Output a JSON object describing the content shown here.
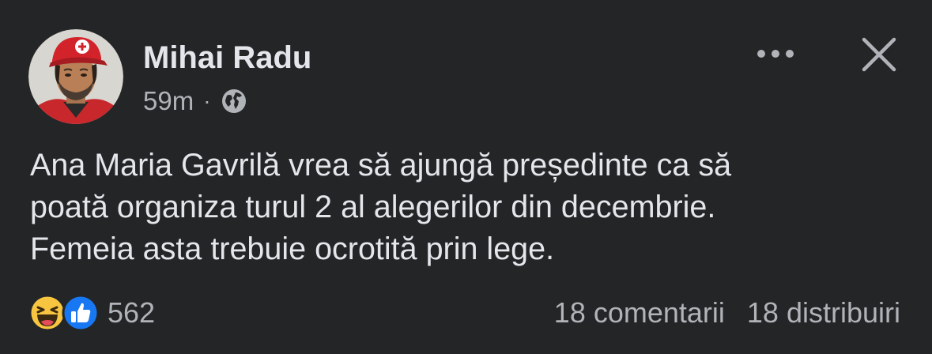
{
  "post": {
    "author": {
      "name": "Mihai Radu",
      "avatar_icon": "profile-photo"
    },
    "time": "59m",
    "separator": "·",
    "audience_icon": "globe-icon",
    "more_icon": "more-options-icon",
    "close_icon": "close-icon",
    "text_lines": [
      "Ana Maria Gavrilă vrea să ajungă președinte ca să",
      "poată organiza turul 2 al alegerilor din decembrie.",
      "Femeia asta trebuie ocrotită prin lege."
    ],
    "reactions": {
      "icons": [
        "haha-reaction-icon",
        "like-reaction-icon"
      ],
      "count": "562"
    },
    "comments": "18 comentarii",
    "shares": "18 distribuiri"
  },
  "colors": {
    "background": "#242526",
    "primary_text": "#e4e6eb",
    "secondary_text": "#b0b3b8",
    "like_blue": "#1877f2",
    "haha_yellow": "#f7c53f"
  }
}
